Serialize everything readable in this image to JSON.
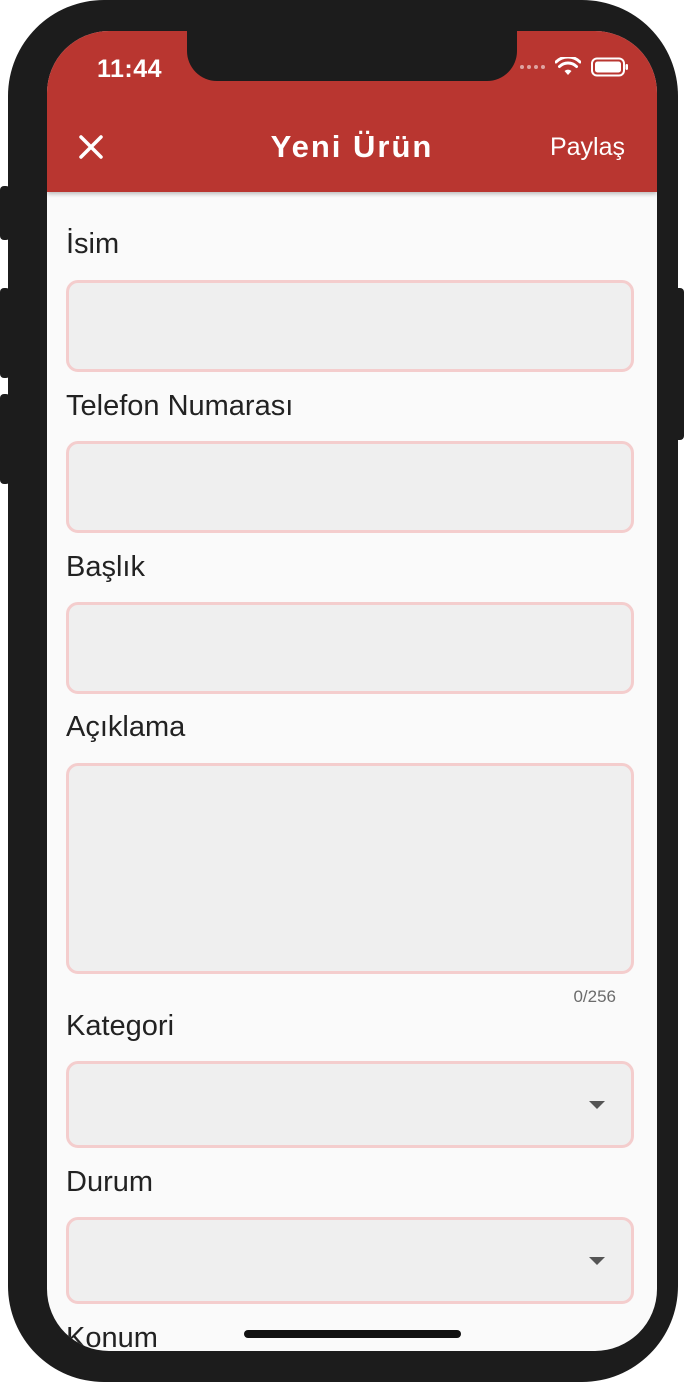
{
  "status_bar": {
    "time": "11:44"
  },
  "app_bar": {
    "title": "Yeni Ürün",
    "close_icon": "close-icon",
    "share_label": "Paylaş",
    "color": "#b93630"
  },
  "form": {
    "name": {
      "label": "İsim",
      "value": ""
    },
    "phone": {
      "label": "Telefon Numarası",
      "value": ""
    },
    "title": {
      "label": "Başlık",
      "value": ""
    },
    "description": {
      "label": "Açıklama",
      "value": "",
      "counter": "0/256"
    },
    "category": {
      "label": "Kategori",
      "value": ""
    },
    "condition": {
      "label": "Durum",
      "value": ""
    },
    "location": {
      "label": "Konum"
    }
  },
  "colors": {
    "field_bg": "#efefef",
    "field_border": "#f4cdcd",
    "page_bg": "#fafafa"
  }
}
